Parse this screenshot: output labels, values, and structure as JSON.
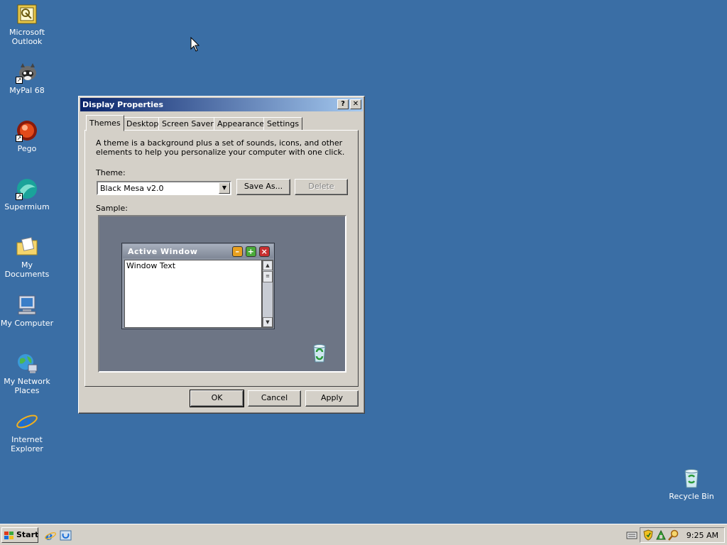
{
  "desktop": {
    "icons": [
      {
        "label": "Microsoft Outlook"
      },
      {
        "label": "MyPal 68"
      },
      {
        "label": "Pego"
      },
      {
        "label": "Supermium"
      },
      {
        "label": "My Documents"
      },
      {
        "label": "My Computer"
      },
      {
        "label": "My Network Places"
      },
      {
        "label": "Internet Explorer"
      },
      {
        "label": "Recycle Bin"
      }
    ],
    "background_color": "#3a6ea5"
  },
  "dialog": {
    "title": "Display Properties",
    "help_glyph": "?",
    "close_glyph": "✕",
    "tabs": [
      {
        "label": "Themes",
        "active": true
      },
      {
        "label": "Desktop"
      },
      {
        "label": "Screen Saver"
      },
      {
        "label": "Appearance"
      },
      {
        "label": "Settings"
      }
    ],
    "description": "A theme is a background plus a set of sounds, icons, and other elements to help you personalize your computer with one click.",
    "theme_label": "Theme:",
    "theme_value": "Black Mesa v2.0",
    "save_as_label": "Save As...",
    "delete_label": "Delete",
    "sample_label": "Sample:",
    "sample": {
      "window_title": "Active Window",
      "window_text": "Window Text"
    },
    "ok_label": "OK",
    "cancel_label": "Cancel",
    "apply_label": "Apply"
  },
  "taskbar": {
    "start_label": "Start",
    "clock": "9:25 AM"
  }
}
